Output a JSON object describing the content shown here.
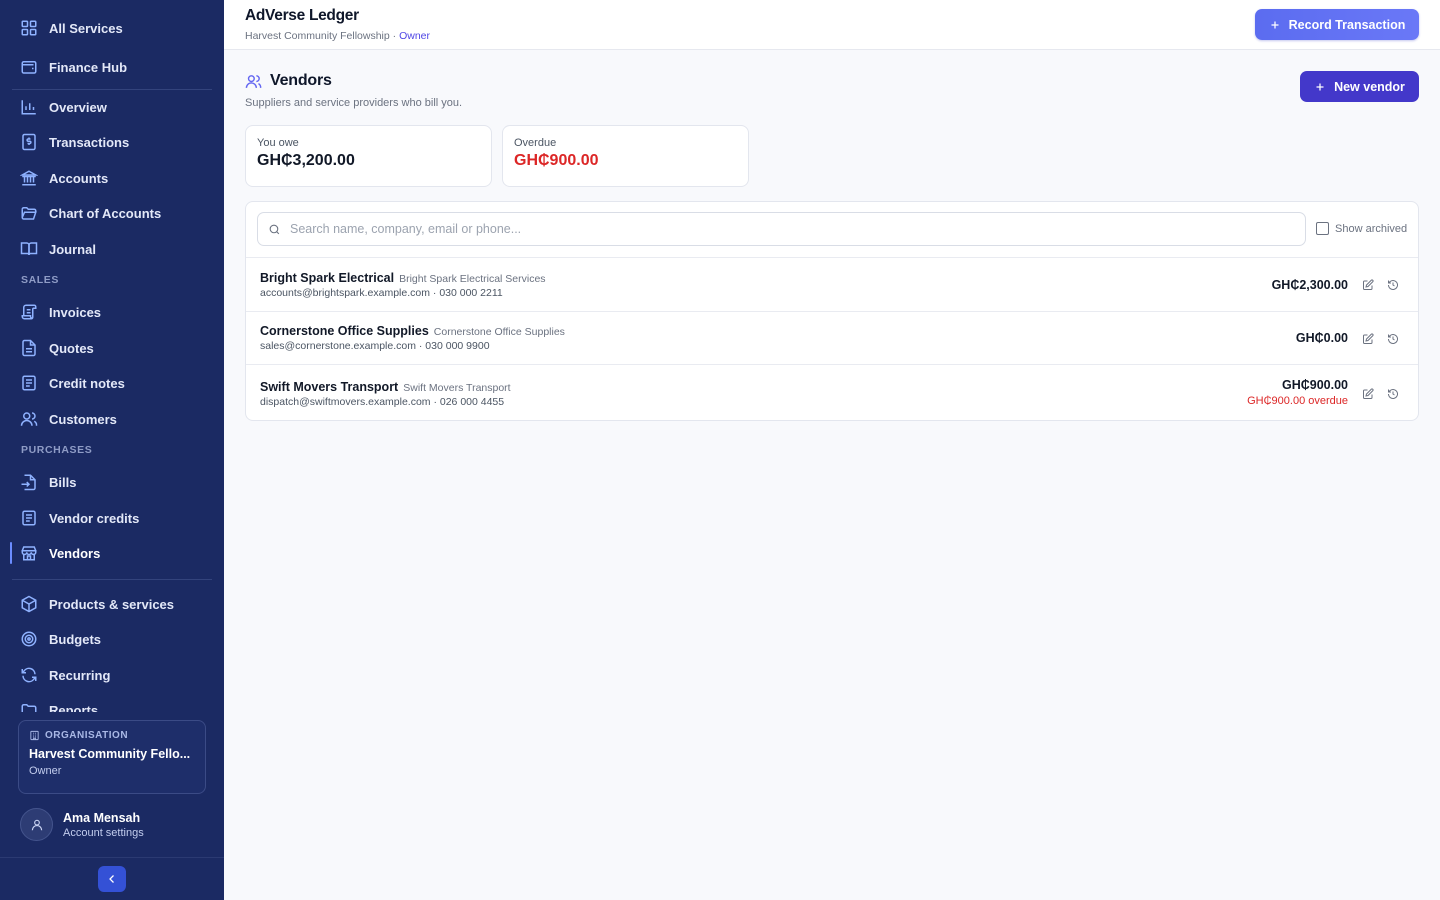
{
  "sidebar": {
    "top_items": [
      {
        "label": "All Services",
        "icon": "grid-icon"
      },
      {
        "label": "Finance Hub",
        "icon": "wallet-icon"
      }
    ],
    "items": [
      {
        "label": "Overview",
        "icon": "bar-chart-icon"
      },
      {
        "label": "Transactions",
        "icon": "receipt-dollar-icon"
      },
      {
        "label": "Accounts",
        "icon": "bank-icon"
      },
      {
        "label": "Chart of Accounts",
        "icon": "folder-open-icon"
      },
      {
        "label": "Journal",
        "icon": "book-open-icon"
      }
    ],
    "sales_label": "SALES",
    "sales_items": [
      {
        "label": "Invoices",
        "icon": "scroll-icon"
      },
      {
        "label": "Quotes",
        "icon": "file-text-icon"
      },
      {
        "label": "Credit notes",
        "icon": "notepad-icon"
      },
      {
        "label": "Customers",
        "icon": "users-icon"
      }
    ],
    "purchases_label": "PURCHASES",
    "purchases_items": [
      {
        "label": "Bills",
        "icon": "file-import-icon"
      },
      {
        "label": "Vendor credits",
        "icon": "notepad-icon"
      },
      {
        "label": "Vendors",
        "icon": "store-icon"
      }
    ],
    "more_items": [
      {
        "label": "Products & services",
        "icon": "package-icon"
      },
      {
        "label": "Budgets",
        "icon": "target-icon"
      },
      {
        "label": "Recurring",
        "icon": "refresh-icon"
      },
      {
        "label": "Reports",
        "icon": "folder-icon"
      }
    ],
    "org": {
      "label": "ORGANISATION",
      "name": "Harvest Community Fello...",
      "role": "Owner"
    },
    "user": {
      "name": "Ama Mensah",
      "sub": "Account settings"
    }
  },
  "header": {
    "title": "AdVerse Ledger",
    "org": "Harvest Community Fellowship",
    "sep": " · ",
    "role": "Owner",
    "record_label": "Record Transaction"
  },
  "page": {
    "title": "Vendors",
    "subtitle": "Suppliers and service providers who bill you.",
    "new_label": "New vendor"
  },
  "stats": [
    {
      "label": "You owe",
      "value": "GH₵3,200.00"
    },
    {
      "label": "Overdue",
      "value": "GH₵900.00"
    }
  ],
  "search": {
    "placeholder": "Search name, company, email or phone...",
    "value": ""
  },
  "show_archived_label": "Show archived",
  "vendors": [
    {
      "name": "Bright Spark Electrical",
      "company": "Bright Spark Electrical Services",
      "contact": "accounts@brightspark.example.com · 030 000 2211",
      "amount": "GH₵2,300.00",
      "overdue": ""
    },
    {
      "name": "Cornerstone Office Supplies",
      "company": "Cornerstone Office Supplies",
      "contact": "sales@cornerstone.example.com · 030 000 9900",
      "amount": "GH₵0.00",
      "overdue": ""
    },
    {
      "name": "Swift Movers Transport",
      "company": "Swift Movers Transport",
      "contact": "dispatch@swiftmovers.example.com · 026 000 4455",
      "amount": "GH₵900.00",
      "overdue": "GH₵900.00 overdue"
    }
  ],
  "colors": {
    "sidebar_bg": "#1b2a63",
    "accent": "#4338ca",
    "icon_blue": "#8fb2ff",
    "danger": "#dc2626"
  }
}
